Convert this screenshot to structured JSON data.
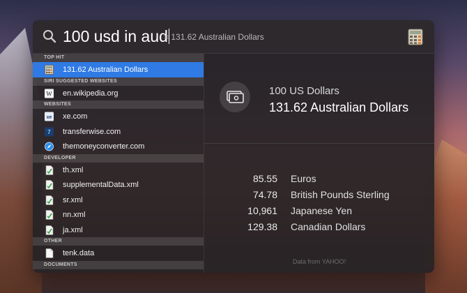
{
  "search": {
    "query": "100 usd in aud",
    "inline_result": "= 131.62 Australian Dollars"
  },
  "sections": [
    {
      "title": "TOP HIT",
      "items": [
        {
          "label": "131.62 Australian Dollars",
          "icon": "calculator-icon",
          "selected": true
        }
      ]
    },
    {
      "title": "SIRI SUGGESTED WEBSITES",
      "items": [
        {
          "label": "en.wikipedia.org",
          "icon": "wikipedia-icon"
        }
      ]
    },
    {
      "title": "WEBSITES",
      "items": [
        {
          "label": "xe.com",
          "icon": "xe-icon"
        },
        {
          "label": "transferwise.com",
          "icon": "transferwise-icon"
        },
        {
          "label": "themoneyconverter.com",
          "icon": "safari-icon"
        }
      ]
    },
    {
      "title": "DEVELOPER",
      "items": [
        {
          "label": "th.xml",
          "icon": "xml-file-icon"
        },
        {
          "label": "supplementalData.xml",
          "icon": "xml-file-icon"
        },
        {
          "label": "sr.xml",
          "icon": "xml-file-icon"
        },
        {
          "label": "nn.xml",
          "icon": "xml-file-icon"
        },
        {
          "label": "ja.xml",
          "icon": "xml-file-icon"
        }
      ]
    },
    {
      "title": "OTHER",
      "items": [
        {
          "label": "tenk.data",
          "icon": "document-icon"
        }
      ]
    },
    {
      "title": "DOCUMENTS",
      "items": []
    }
  ],
  "detail": {
    "icon": "currency-icon",
    "title": "100 US Dollars",
    "result": "131.62 Australian Dollars",
    "rates": [
      {
        "value": "85.55",
        "name": "Euros"
      },
      {
        "value": "74.78",
        "name": "British Pounds Sterling"
      },
      {
        "value": "10,961",
        "name": "Japanese Yen"
      },
      {
        "value": "129.38",
        "name": "Canadian Dollars"
      }
    ],
    "credit": "Data from YAHOO!"
  },
  "colors": {
    "selection": "#2f7ae4",
    "panel": "#262226"
  }
}
